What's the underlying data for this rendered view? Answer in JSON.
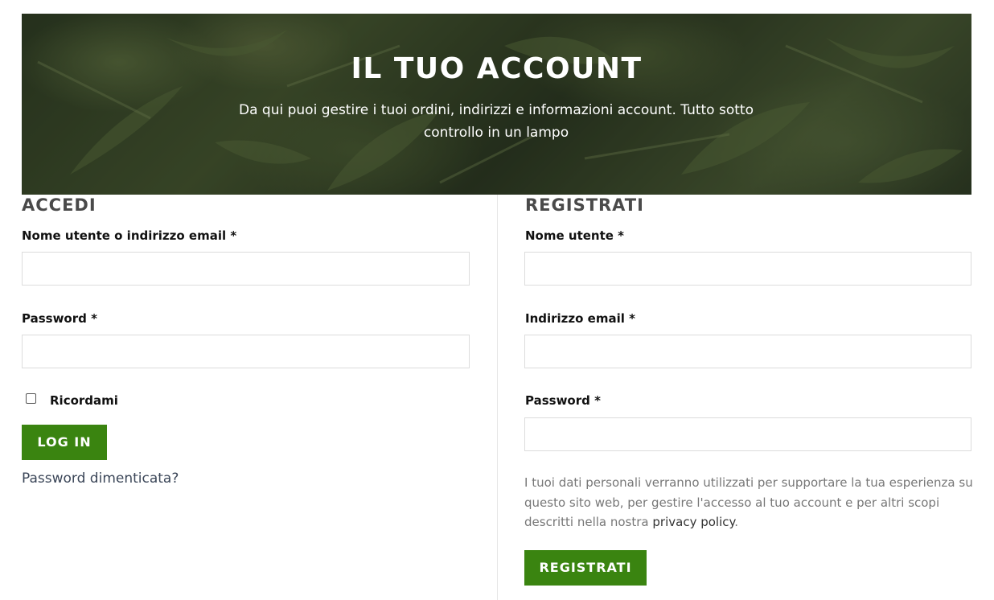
{
  "hero": {
    "title": "IL TUO ACCOUNT",
    "subtitle": "Da qui puoi gestire i tuoi ordini, indirizzi e informazioni account. Tutto sotto controllo in un lampo"
  },
  "login": {
    "title": "ACCEDI",
    "username_label": "Nome utente o indirizzo email *",
    "username_value": "",
    "password_label": "Password *",
    "password_value": "",
    "remember_label": "Ricordami",
    "remember_checked": false,
    "submit_label": "LOG IN",
    "lost_password_label": "Password dimenticata?"
  },
  "register": {
    "title": "REGISTRATI",
    "username_label": "Nome utente *",
    "username_value": "",
    "email_label": "Indirizzo email *",
    "email_value": "",
    "password_label": "Password *",
    "password_value": "",
    "privacy_text": "I tuoi dati personali verranno utilizzati per supportare la tua esperienza su questo sito web, per gestire l'accesso al tuo account e per altri scopi descritti nella nostra",
    "privacy_link": "privacy policy",
    "privacy_end": ".",
    "submit_label": "REGISTRATI"
  },
  "colors": {
    "accent": "#3a8410",
    "heading": "#4a4a4a",
    "hero_bg": "#2d3a22"
  }
}
